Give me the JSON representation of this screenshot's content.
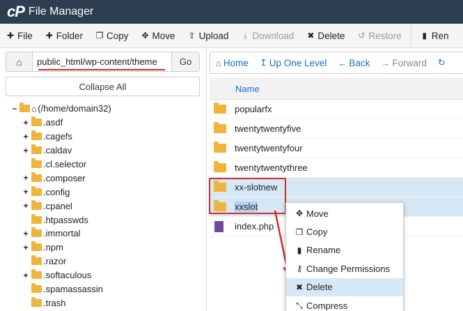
{
  "app": {
    "logo": "cP",
    "title": "File Manager"
  },
  "toolbar": [
    {
      "icon": "plus-icon",
      "glyph": "✚",
      "label": "File",
      "disabled": false
    },
    {
      "icon": "plus-icon",
      "glyph": "✚",
      "label": "Folder",
      "disabled": false
    },
    {
      "icon": "copy-icon",
      "glyph": "❐",
      "label": "Copy",
      "disabled": false
    },
    {
      "icon": "move-icon",
      "glyph": "✥",
      "label": "Move",
      "disabled": false
    },
    {
      "icon": "upload-icon",
      "glyph": "⇪",
      "label": "Upload",
      "disabled": false
    },
    {
      "icon": "download-icon",
      "glyph": "⤓",
      "label": "Download",
      "disabled": true
    },
    {
      "icon": "delete-icon",
      "glyph": "✖",
      "label": "Delete",
      "disabled": false
    },
    {
      "icon": "restore-icon",
      "glyph": "↺",
      "label": "Restore",
      "disabled": true
    },
    {
      "icon": "rename-icon",
      "glyph": "▮",
      "label": "Ren",
      "disabled": false
    }
  ],
  "path": {
    "value": "public_html/wp-content/theme",
    "go_label": "Go"
  },
  "collapse_label": "Collapse All",
  "tree": {
    "root_label": "(/home/domain32)",
    "items": [
      {
        "label": ".asdf",
        "expandable": true
      },
      {
        "label": ".cagefs",
        "expandable": true
      },
      {
        "label": ".caldav",
        "expandable": true
      },
      {
        "label": ".cl.selector",
        "expandable": false
      },
      {
        "label": ".composer",
        "expandable": true
      },
      {
        "label": ".config",
        "expandable": true
      },
      {
        "label": ".cpanel",
        "expandable": true
      },
      {
        "label": ".htpasswds",
        "expandable": false
      },
      {
        "label": ".immortal",
        "expandable": true
      },
      {
        "label": ".npm",
        "expandable": true
      },
      {
        "label": ".razor",
        "expandable": false
      },
      {
        "label": ".softaculous",
        "expandable": true
      },
      {
        "label": ".spamassassin",
        "expandable": false
      },
      {
        "label": ".trash",
        "expandable": false
      }
    ]
  },
  "nav": [
    {
      "icon": "home-icon",
      "glyph": "⌂",
      "label": "Home",
      "disabled": false
    },
    {
      "icon": "up-level-icon",
      "glyph": "↥",
      "label": "Up One Level",
      "disabled": false
    },
    {
      "icon": "back-icon",
      "glyph": "←",
      "label": "Back",
      "disabled": false
    },
    {
      "icon": "forward-icon",
      "glyph": "→",
      "label": "Forward",
      "disabled": true
    },
    {
      "icon": "reload-icon",
      "glyph": "↻",
      "label": "",
      "disabled": false
    }
  ],
  "list": {
    "header": "Name",
    "files": [
      {
        "name": "popularfx",
        "type": "folder",
        "selected": false
      },
      {
        "name": "twentytwentyfive",
        "type": "folder",
        "selected": false
      },
      {
        "name": "twentytwentyfour",
        "type": "folder",
        "selected": false
      },
      {
        "name": "twentytwentythree",
        "type": "folder",
        "selected": false
      },
      {
        "name": "xx-slotnew",
        "type": "folder",
        "selected": true
      },
      {
        "name": "xxslot",
        "type": "folder",
        "selected": true
      },
      {
        "name": "index.php",
        "type": "file",
        "selected": false
      }
    ]
  },
  "context_menu": [
    {
      "icon": "move-icon",
      "glyph": "✥",
      "label": "Move"
    },
    {
      "icon": "copy-icon",
      "glyph": "❐",
      "label": "Copy"
    },
    {
      "icon": "rename-icon",
      "glyph": "▮",
      "label": "Rename"
    },
    {
      "icon": "key-icon",
      "glyph": "⚷",
      "label": "Change Permissions"
    },
    {
      "icon": "delete-icon",
      "glyph": "✖",
      "label": "Delete"
    },
    {
      "icon": "compress-icon",
      "glyph": "⤡",
      "label": "Compress"
    }
  ],
  "colors": {
    "topbar": "#2c3e50",
    "link": "#1a6fbf",
    "folder": "#f0b43c",
    "selected": "#d6e8f5",
    "annotation": "#d42a2a"
  }
}
